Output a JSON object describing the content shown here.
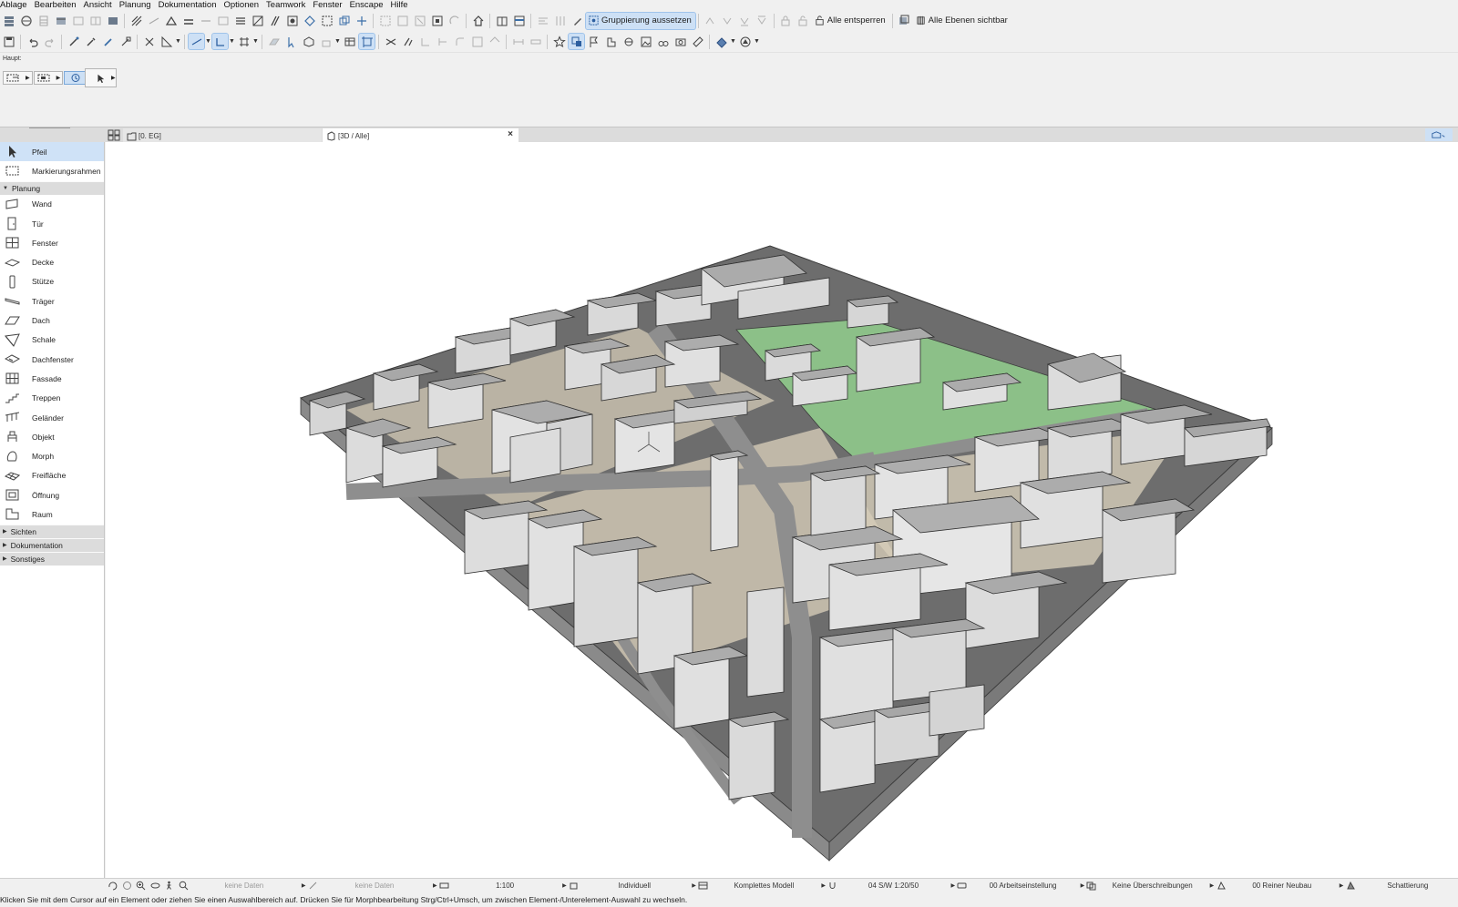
{
  "menu": [
    "Ablage",
    "Bearbeiten",
    "Ansicht",
    "Planung",
    "Dokumentation",
    "Optionen",
    "Teamwork",
    "Fenster",
    "Enscape",
    "Hilfe"
  ],
  "toolbar": {
    "group_suspend_label": "Gruppierung aussetzen",
    "unlock_all_label": "Alle entsperren",
    "all_layers_visible_label": "Alle Ebenen sichtbar"
  },
  "infobox": {
    "label": "Haupt:"
  },
  "tabs": {
    "plan": "[0. EG]",
    "view3d": "[3D / Alle]"
  },
  "toolbox": {
    "top_tools": [
      {
        "label": "Pfeil",
        "icon": "arrow-pointer-icon",
        "selected": true
      },
      {
        "label": "Markierungsrahmen",
        "icon": "marquee-icon",
        "selected": false
      }
    ],
    "design_group": "Planung",
    "design_tools": [
      {
        "label": "Wand",
        "icon": "wall-icon"
      },
      {
        "label": "Tür",
        "icon": "door-icon"
      },
      {
        "label": "Fenster",
        "icon": "window-icon"
      },
      {
        "label": "Decke",
        "icon": "slab-icon"
      },
      {
        "label": "Stütze",
        "icon": "column-icon"
      },
      {
        "label": "Träger",
        "icon": "beam-icon"
      },
      {
        "label": "Dach",
        "icon": "roof-icon"
      },
      {
        "label": "Schale",
        "icon": "shell-icon"
      },
      {
        "label": "Dachfenster",
        "icon": "skylight-icon"
      },
      {
        "label": "Fassade",
        "icon": "curtain-wall-icon"
      },
      {
        "label": "Treppen",
        "icon": "stair-icon"
      },
      {
        "label": "Geländer",
        "icon": "railing-icon"
      },
      {
        "label": "Objekt",
        "icon": "object-icon"
      },
      {
        "label": "Morph",
        "icon": "morph-icon"
      },
      {
        "label": "Freifläche",
        "icon": "mesh-icon"
      },
      {
        "label": "Öffnung",
        "icon": "opening-icon"
      },
      {
        "label": "Raum",
        "icon": "zone-icon"
      }
    ],
    "groups": [
      "Sichten",
      "Dokumentation",
      "Sonstiges"
    ]
  },
  "quickbar": {
    "nodata1": "keine Daten",
    "nodata2": "keine Daten",
    "scale": "1:100",
    "pen_set": "Individuell",
    "model_view": "Komplettes Modell",
    "layer_combo": "04 S/W 1:20/50",
    "graphic_override": "00 Arbeitseinstellung",
    "overrides": "Keine Überschreibungen",
    "renovation": "00 Reiner Neubau",
    "shading": "Schattierung"
  },
  "status": {
    "message": "Klicken Sie mit dem Cursor auf ein Element oder ziehen Sie einen Auswahlbereich auf. Drücken Sie für Morphbearbeitung Strg/Ctrl+Umsch, um zwischen Element-/Unterelement-Auswahl zu wechseln."
  },
  "colors": {
    "accent": "#cde0f5",
    "ground": "#6e6e6e",
    "green": "#8cc088",
    "building_top": "#a8a8a8",
    "building_side": "#d9d9d9"
  }
}
